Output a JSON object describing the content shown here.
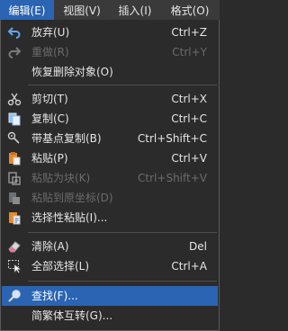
{
  "menubar": {
    "items": [
      {
        "label": "编辑(E)"
      },
      {
        "label": "视图(V)"
      },
      {
        "label": "插入(I)"
      },
      {
        "label": "格式(O)"
      }
    ]
  },
  "menu": {
    "undo": {
      "label": "放弃(U)",
      "shortcut": "Ctrl+Z"
    },
    "redo": {
      "label": "重做(R)",
      "shortcut": "Ctrl+Y"
    },
    "restore_deleted": {
      "label": "恢复删除对象(O)"
    },
    "cut": {
      "label": "剪切(T)",
      "shortcut": "Ctrl+X"
    },
    "copy": {
      "label": "复制(C)",
      "shortcut": "Ctrl+C"
    },
    "copy_base": {
      "label": "带基点复制(B)",
      "shortcut": "Ctrl+Shift+C"
    },
    "paste": {
      "label": "粘贴(P)",
      "shortcut": "Ctrl+V"
    },
    "paste_block": {
      "label": "粘贴为块(K)",
      "shortcut": "Ctrl+Shift+V"
    },
    "paste_orig": {
      "label": "粘贴到原坐标(D)"
    },
    "paste_special": {
      "label": "选择性粘贴(I)..."
    },
    "clear": {
      "label": "清除(A)",
      "shortcut": "Del"
    },
    "select_all": {
      "label": "全部选择(L)",
      "shortcut": "Ctrl+A"
    },
    "find": {
      "label": "查找(F)..."
    },
    "convert": {
      "label": "简繁体互转(G)..."
    }
  },
  "colors": {
    "highlight": "#2a64b3",
    "background": "#2b2b2b"
  }
}
